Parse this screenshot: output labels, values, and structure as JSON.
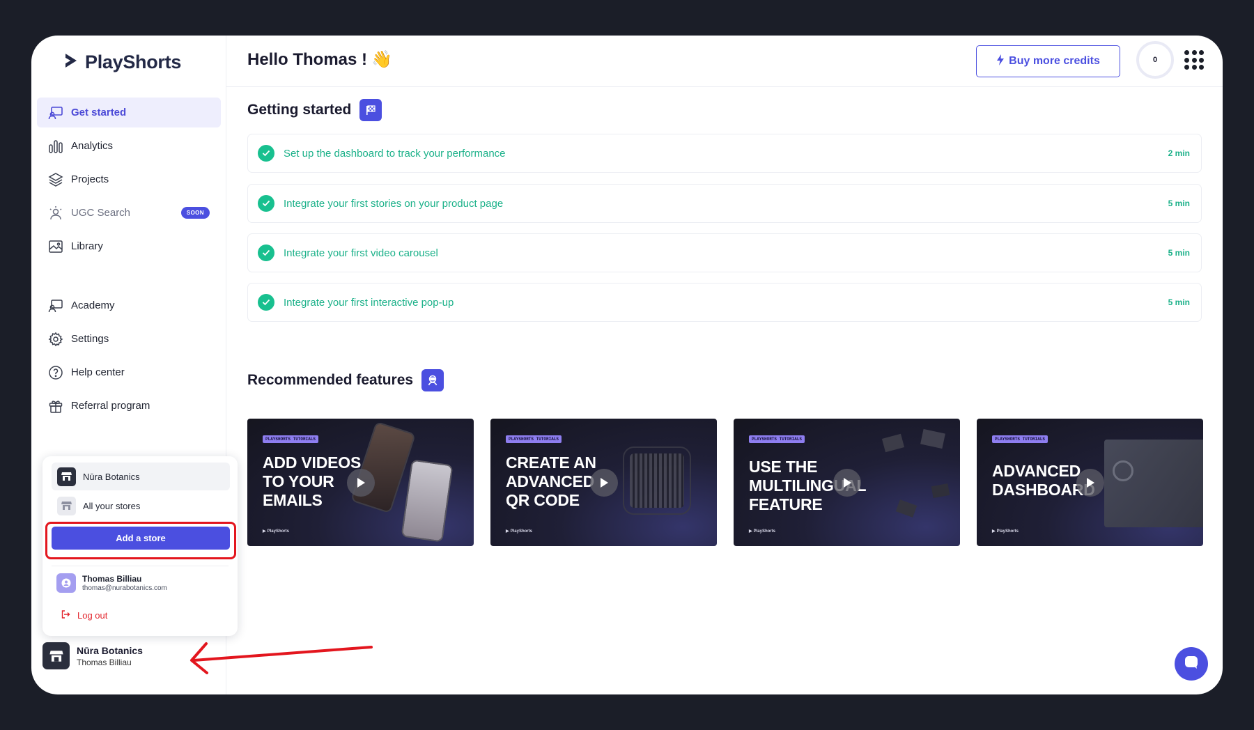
{
  "brand": {
    "name": "PlayShorts"
  },
  "sidebar": {
    "items": [
      {
        "label": "Get started",
        "icon": "get-started-icon"
      },
      {
        "label": "Analytics",
        "icon": "analytics-icon"
      },
      {
        "label": "Projects",
        "icon": "layers-icon"
      },
      {
        "label": "UGC Search",
        "icon": "ugc-search-icon",
        "badge": "SOON"
      },
      {
        "label": "Library",
        "icon": "image-icon"
      },
      {
        "label": "Academy",
        "icon": "academy-icon"
      },
      {
        "label": "Settings",
        "icon": "gear-icon"
      },
      {
        "label": "Help center",
        "icon": "help-icon"
      },
      {
        "label": "Referral program",
        "icon": "gift-icon"
      }
    ]
  },
  "store_menu": {
    "stores": [
      {
        "label": "Nūra Botanics"
      },
      {
        "label": "All your stores"
      }
    ],
    "add_store_label": "Add a store",
    "user": {
      "name": "Thomas Billiau",
      "email": "thomas@nurabotanics.com"
    },
    "logout_label": "Log out"
  },
  "current_store": {
    "name": "Nūra Botanics",
    "user": "Thomas Billiau"
  },
  "header": {
    "greeting": "Hello Thomas !",
    "greeting_emoji": "👋",
    "buy_credits_label": "Buy more credits",
    "credits": "0"
  },
  "getting_started": {
    "title": "Getting started",
    "tasks": [
      {
        "label": "Set up the dashboard to track your performance",
        "time": "2 min"
      },
      {
        "label": "Integrate your first stories on your product page",
        "time": "5 min"
      },
      {
        "label": "Integrate your first video carousel",
        "time": "5 min"
      },
      {
        "label": "Integrate your first interactive pop-up",
        "time": "5 min"
      }
    ]
  },
  "recommended": {
    "title": "Recommended features",
    "videos": [
      {
        "tag": "PLAYSHORTS TUTORIALS",
        "title": "ADD VIDEOS\nTO YOUR\nEMAILS",
        "brand": "PlayShorts"
      },
      {
        "tag": "PLAYSHORTS TUTORIALS",
        "title": "CREATE AN\nADVANCED\nQR CODE",
        "brand": "PlayShorts"
      },
      {
        "tag": "PLAYSHORTS TUTORIALS",
        "title": "USE THE\nMULTILINGUAL\nFEATURE",
        "brand": "PlayShorts"
      },
      {
        "tag": "PLAYSHORTS TUTORIALS",
        "title": "ADVANCED\nDASHBOARD",
        "brand": "PlayShorts"
      }
    ]
  },
  "colors": {
    "accent": "#4b4fe0",
    "success": "#1bb189",
    "danger": "#e3161e",
    "frame": "#1b1e28"
  }
}
